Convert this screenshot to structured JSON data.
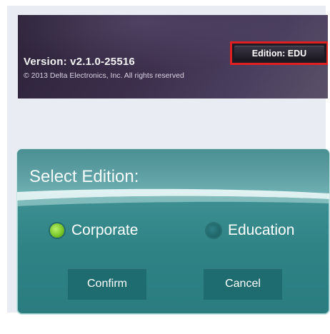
{
  "header": {
    "version": "Version:  v2.1.0-25516",
    "copyright": "© 2013 Delta Electronics, Inc. All rights reserved",
    "edition_button": "Edition: EDU"
  },
  "dialog": {
    "title": "Select Edition:",
    "options": [
      {
        "label": "Corporate",
        "selected": true
      },
      {
        "label": "Education",
        "selected": false
      }
    ],
    "confirm_label": "Confirm",
    "cancel_label": "Cancel"
  },
  "colors": {
    "highlight_border": "#e02020",
    "dialog_teal": "#3d8f92",
    "radio_selected": "#7cc82a"
  }
}
